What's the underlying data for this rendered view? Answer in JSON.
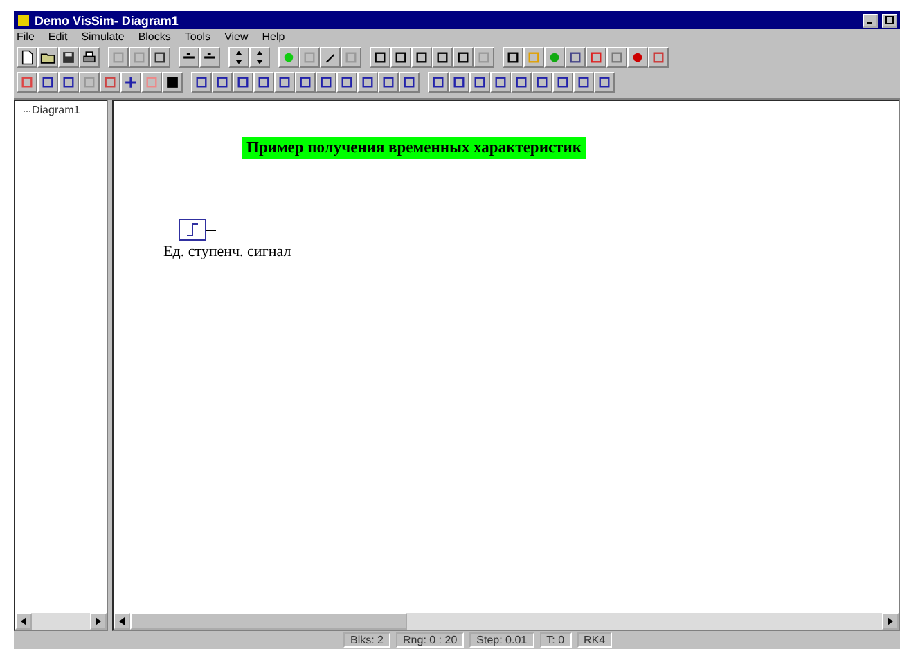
{
  "window": {
    "title": "Demo VisSim- Diagram1"
  },
  "menu": [
    "File",
    "Edit",
    "Simulate",
    "Blocks",
    "Tools",
    "View",
    "Help"
  ],
  "tree": {
    "items": [
      {
        "label": "Diagram1"
      }
    ]
  },
  "canvas": {
    "title": "Пример получения временных характеристик",
    "blocks": [
      {
        "kind": "step",
        "label": "Ед. ступенч. сигнал"
      }
    ]
  },
  "status_bar": [
    "Blks: 2",
    "Rng: 0 : 20",
    "Step: 0.01",
    "T: 0",
    "RK4"
  ]
}
